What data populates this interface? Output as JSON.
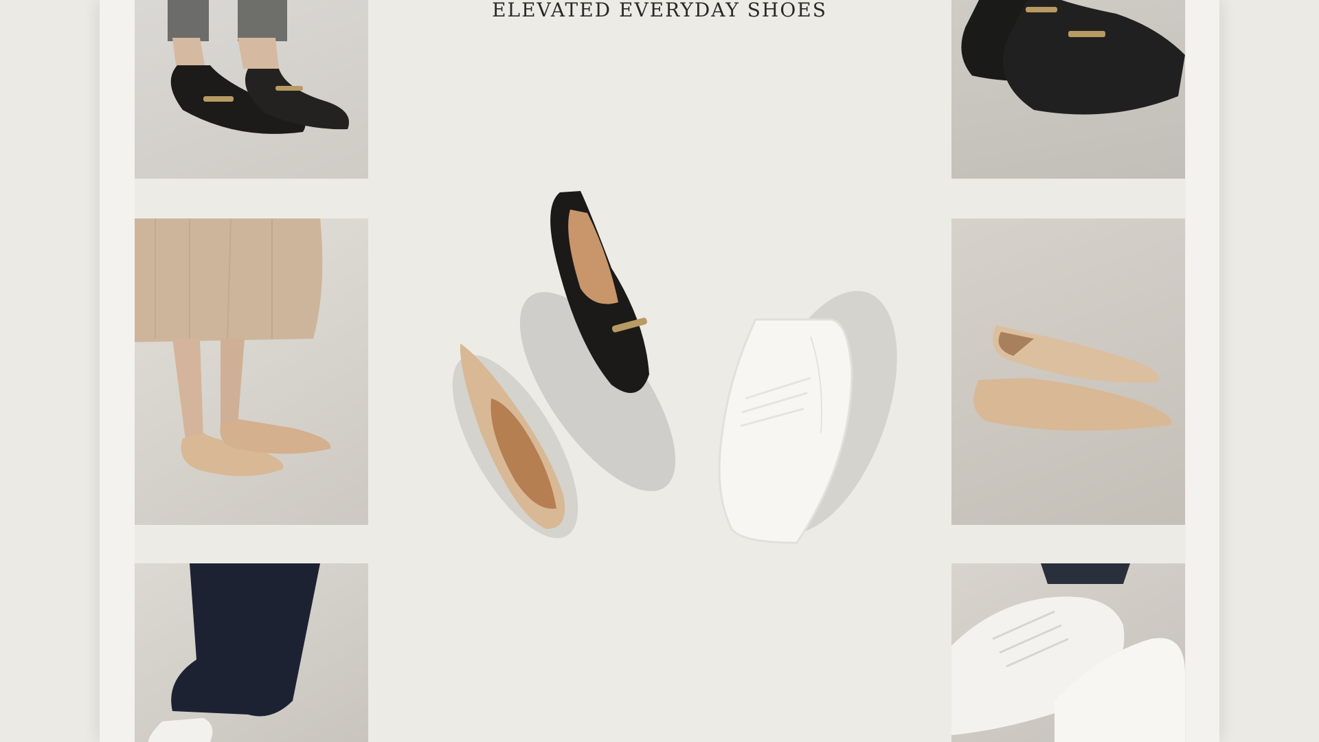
{
  "poster": {
    "title": "ELEVATED EVERYDAY SHOES"
  },
  "colors": {
    "background": "#ecebe6",
    "black_leather": "#1b1a19",
    "nude": "#d9b895",
    "white_leather": "#f7f6f3",
    "gold": "#b89a63"
  },
  "tiles": [
    {
      "name": "black-horsebit-loafers-worn"
    },
    {
      "name": "nude-pointed-flats-worn"
    },
    {
      "name": "white-sneakers-worn-with-jeans"
    },
    {
      "name": "black-horsebit-loafers-closeup"
    },
    {
      "name": "nude-pointed-flats-pair"
    },
    {
      "name": "white-sneakers-closeup"
    }
  ]
}
